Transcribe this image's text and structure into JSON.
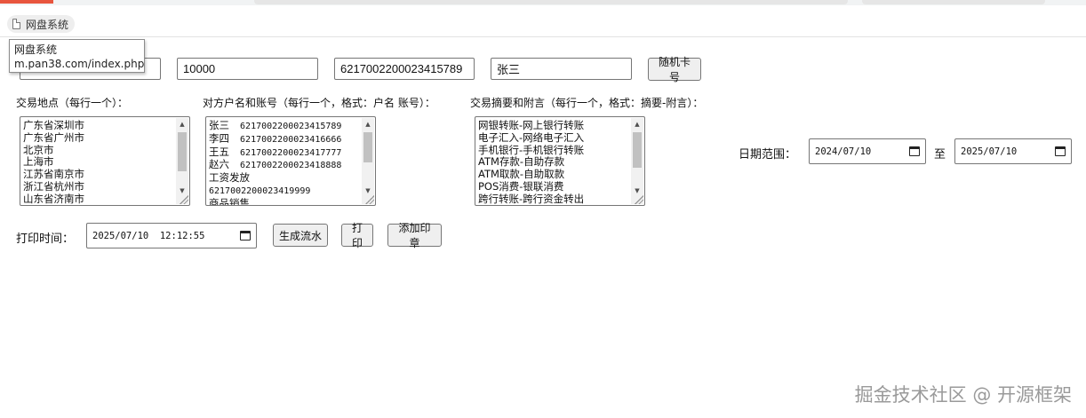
{
  "browser": {
    "bookmark_label": "网盘系统",
    "tooltip_title": "网盘系统",
    "tooltip_url": "m.pan38.com/index.php"
  },
  "account": {
    "amount": "10000",
    "card_number": "6217002200023415789",
    "holder_name": "张三",
    "random_card_button": "随机卡号"
  },
  "locations": {
    "label": "交易地点（每行一个）：",
    "lines": [
      "广东省深圳市",
      "广东省广州市",
      "北京市",
      "上海市",
      "江苏省南京市",
      "浙江省杭州市",
      "山东省济南市"
    ]
  },
  "counterparties": {
    "label": "对方户名和账号（每行一个，格式：户名 账号）：",
    "lines": [
      {
        "name": "张三",
        "account": "6217002200023415789"
      },
      {
        "name": "李四",
        "account": "6217002200023416666"
      },
      {
        "name": "王五",
        "account": "6217002200023417777"
      },
      {
        "name": "赵六",
        "account": "6217002200023418888"
      },
      {
        "name": "工资发放",
        "account": ""
      },
      {
        "name": "",
        "account": "6217002200023419999"
      },
      {
        "name": "商品销售",
        "account": ""
      }
    ]
  },
  "summaries": {
    "label": "交易摘要和附言（每行一个，格式：摘要-附言）：",
    "lines": [
      "网银转账-网上银行转账",
      "电子汇入-网络电子汇入",
      "手机银行-手机银行转账",
      "ATM存款-自助存款",
      "ATM取款-自助取款",
      "POS消费-银联消费",
      "跨行转账-跨行资金转出"
    ]
  },
  "date_range": {
    "label": "日期范围：",
    "start": "2024/07/10",
    "separator": "至",
    "end": "2025/07/10"
  },
  "print": {
    "time_label": "打印时间：",
    "time_value": "2025/07/10  12:12:55",
    "generate_button": "生成流水",
    "print_button": "打印",
    "stamp_button": "添加印章"
  },
  "watermark": "掘金技术社区 @ 开源框架"
}
